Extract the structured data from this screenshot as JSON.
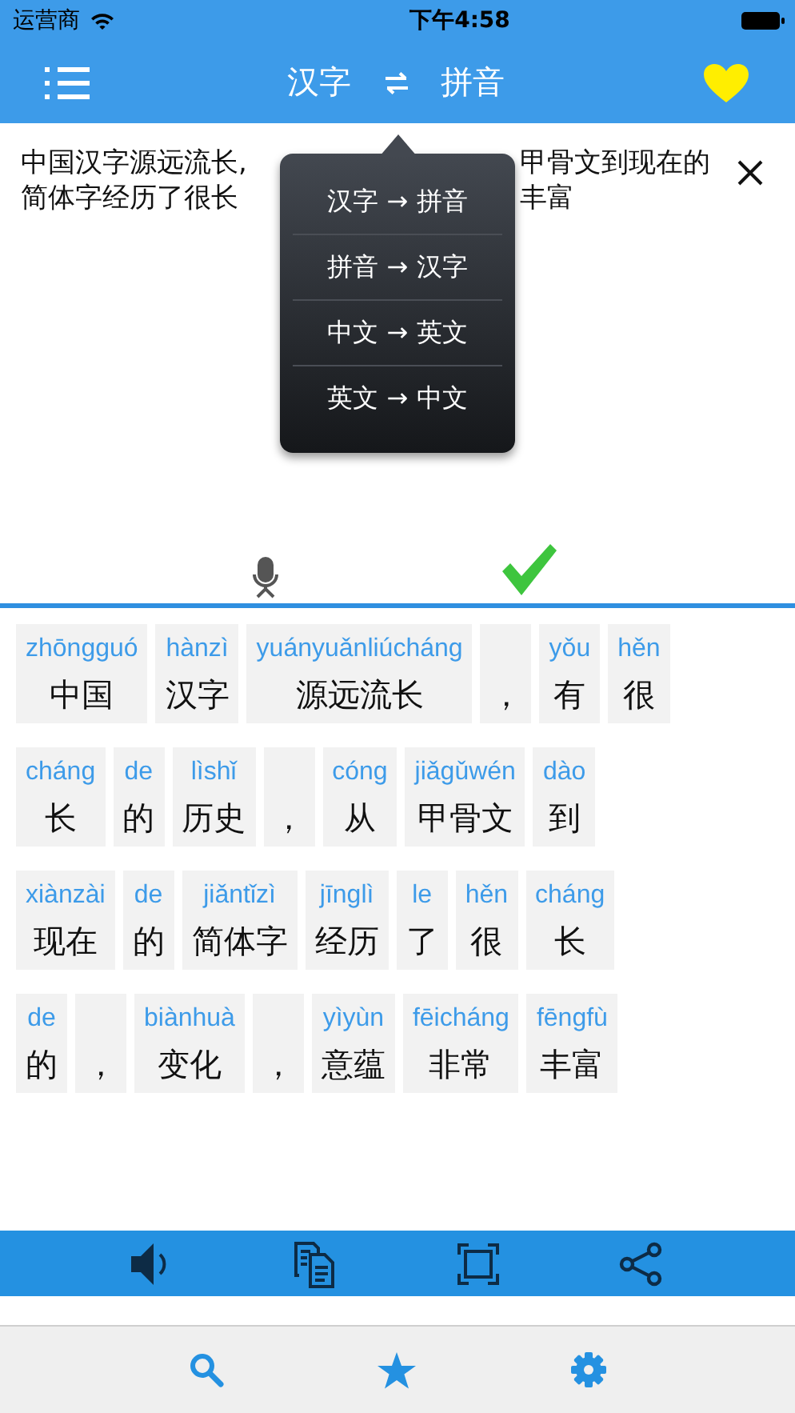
{
  "status_bar": {
    "carrier": "运营商",
    "time": "下午4:58"
  },
  "nav": {
    "source": "汉字",
    "target": "拼音"
  },
  "input": {
    "lines": [
      [
        "中国汉字源远流长,",
        "甲骨文到现在的"
      ],
      [
        "简体字经历了很长",
        "丰富"
      ]
    ]
  },
  "menu": {
    "items": [
      {
        "label": "汉字 → 拼音"
      },
      {
        "label": "拼音 → 汉字"
      },
      {
        "label": "中文 → 英文"
      },
      {
        "label": "英文 → 中文"
      }
    ]
  },
  "token_rows": [
    [
      {
        "pinyin": "zhōngguó",
        "hanzi": "中国"
      },
      {
        "pinyin": "hànzì",
        "hanzi": "汉字"
      },
      {
        "pinyin": "yuányuǎnliúcháng",
        "hanzi": "源远流长"
      },
      {
        "hanzi": "，"
      },
      {
        "pinyin": "yǒu",
        "hanzi": "有"
      },
      {
        "pinyin": "hěn",
        "hanzi": "很"
      }
    ],
    [
      {
        "pinyin": "cháng",
        "hanzi": "长"
      },
      {
        "pinyin": "de",
        "hanzi": "的"
      },
      {
        "pinyin": "lìshǐ",
        "hanzi": "历史"
      },
      {
        "hanzi": "，"
      },
      {
        "pinyin": "cóng",
        "hanzi": "从"
      },
      {
        "pinyin": "jiǎgǔwén",
        "hanzi": "甲骨文"
      },
      {
        "pinyin": "dào",
        "hanzi": "到"
      }
    ],
    [
      {
        "pinyin": "xiànzài",
        "hanzi": "现在"
      },
      {
        "pinyin": "de",
        "hanzi": "的"
      },
      {
        "pinyin": "jiǎntǐzì",
        "hanzi": "简体字"
      },
      {
        "pinyin": "jīnglì",
        "hanzi": "经历"
      },
      {
        "pinyin": "le",
        "hanzi": "了"
      },
      {
        "pinyin": "hěn",
        "hanzi": "很"
      },
      {
        "pinyin": "cháng",
        "hanzi": "长"
      }
    ],
    [
      {
        "pinyin": "de",
        "hanzi": "的"
      },
      {
        "hanzi": "，"
      },
      {
        "pinyin": "biànhuà",
        "hanzi": "变化"
      },
      {
        "hanzi": "，"
      },
      {
        "pinyin": "yìyùn",
        "hanzi": "意蕴"
      },
      {
        "pinyin": "fēicháng",
        "hanzi": "非常"
      },
      {
        "pinyin": "fēngfù",
        "hanzi": "丰富"
      }
    ]
  ]
}
